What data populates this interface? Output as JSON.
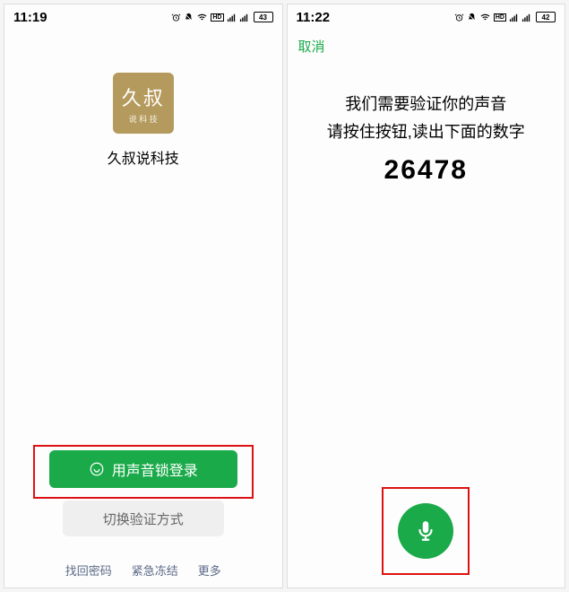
{
  "left": {
    "status": {
      "time": "11:19",
      "battery": "43"
    },
    "app": {
      "icon_big": "久叔",
      "icon_small": "说 科 技",
      "name": "久叔说科技"
    },
    "login_btn": "用声音锁登录",
    "switch_btn": "切换验证方式",
    "footer": {
      "find_pwd": "找回密码",
      "freeze": "紧急冻结",
      "more": "更多"
    }
  },
  "right": {
    "status": {
      "time": "11:22",
      "battery": "42"
    },
    "cancel": "取消",
    "verify_line1": "我们需要验证你的声音",
    "verify_line2": "请按住按钮,读出下面的数字",
    "number": "26478"
  }
}
